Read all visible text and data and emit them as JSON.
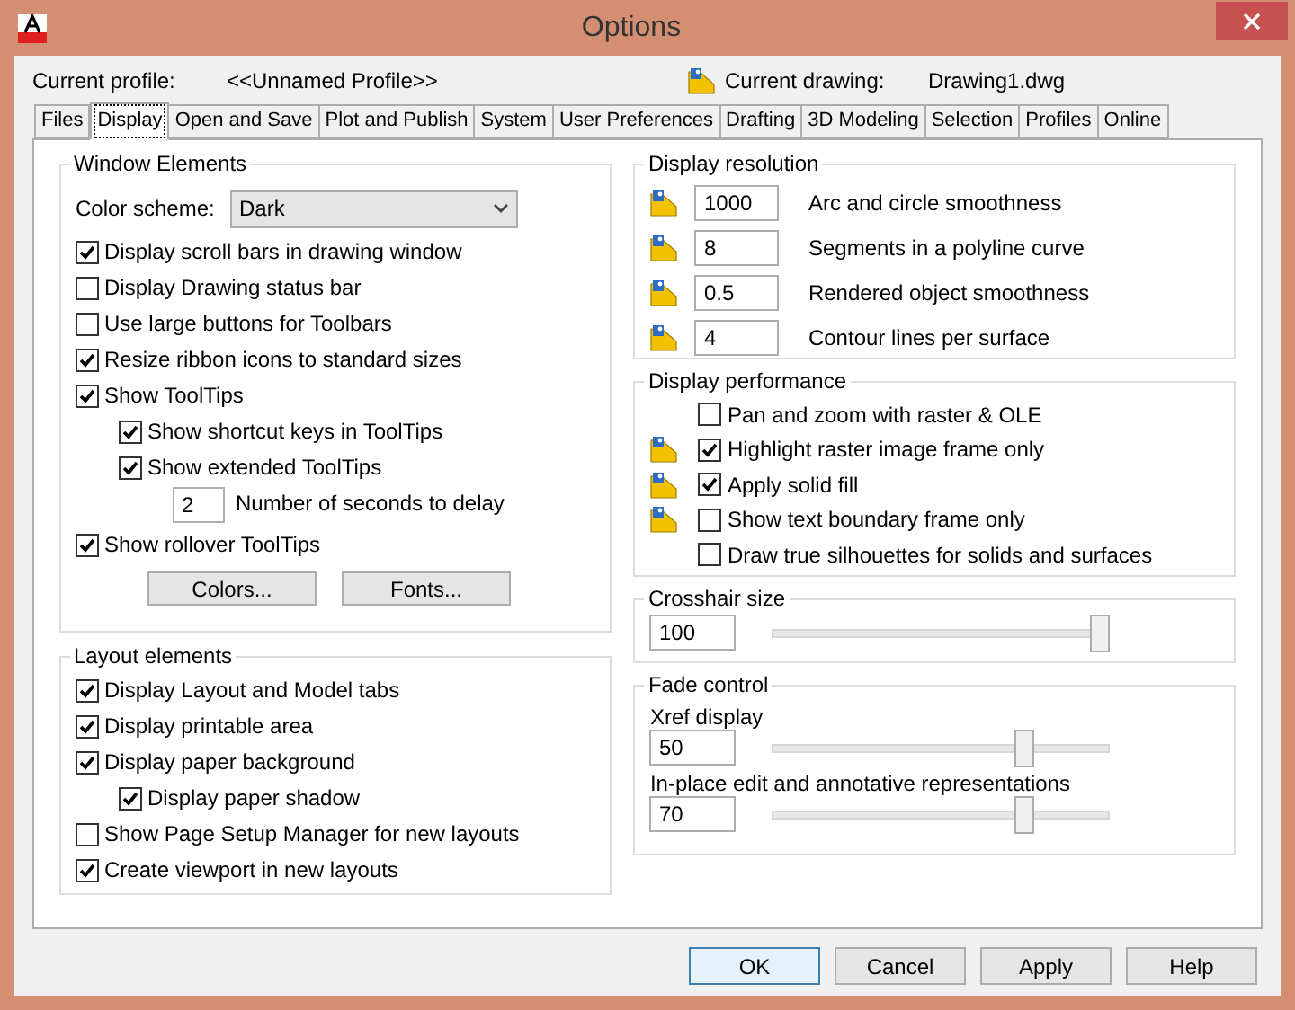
{
  "window": {
    "title": "Options"
  },
  "profile": {
    "label": "Current profile:",
    "value": "<<Unnamed Profile>>"
  },
  "drawing": {
    "label": "Current drawing:",
    "value": "Drawing1.dwg"
  },
  "tabs": [
    {
      "label": "Files",
      "selected": false
    },
    {
      "label": "Display",
      "selected": true
    },
    {
      "label": "Open and Save",
      "selected": false
    },
    {
      "label": "Plot and Publish",
      "selected": false
    },
    {
      "label": "System",
      "selected": false
    },
    {
      "label": "User Preferences",
      "selected": false
    },
    {
      "label": "Drafting",
      "selected": false
    },
    {
      "label": "3D Modeling",
      "selected": false
    },
    {
      "label": "Selection",
      "selected": false
    },
    {
      "label": "Profiles",
      "selected": false
    },
    {
      "label": "Online",
      "selected": false
    }
  ],
  "window_elements": {
    "title": "Window Elements",
    "color_scheme": {
      "label": "Color scheme:",
      "value": "Dark"
    },
    "items": [
      {
        "kind": "checkbox",
        "label": "Display scroll bars in drawing window",
        "checked": true
      },
      {
        "kind": "checkbox",
        "label": "Display Drawing status bar",
        "checked": false
      },
      {
        "kind": "checkbox",
        "label": "Use large buttons for Toolbars",
        "checked": false
      },
      {
        "kind": "checkbox",
        "label": "Resize ribbon icons to standard sizes",
        "checked": true
      },
      {
        "kind": "checkbox",
        "label": "Show ToolTips",
        "checked": true,
        "children": [
          {
            "kind": "checkbox",
            "label": "Show shortcut keys in ToolTips",
            "checked": true
          },
          {
            "kind": "checkbox",
            "label": "Show extended ToolTips",
            "checked": true,
            "children": [
              {
                "kind": "number",
                "value": "2",
                "label": "Number of seconds to delay"
              }
            ]
          }
        ]
      },
      {
        "kind": "checkbox",
        "label": "Show rollover ToolTips",
        "checked": true
      }
    ],
    "buttons": [
      "Colors...",
      "Fonts..."
    ]
  },
  "layout_elements": {
    "title": "Layout elements",
    "items": [
      {
        "kind": "checkbox",
        "label": "Display Layout and Model tabs",
        "checked": true
      },
      {
        "kind": "checkbox",
        "label": "Display printable area",
        "checked": true
      },
      {
        "kind": "checkbox",
        "label": "Display paper background",
        "checked": true,
        "children": [
          {
            "kind": "checkbox",
            "label": "Display paper shadow",
            "checked": true
          }
        ]
      },
      {
        "kind": "checkbox",
        "label": "Show Page Setup Manager for new layouts",
        "checked": false
      },
      {
        "kind": "checkbox",
        "label": "Create viewport in new layouts",
        "checked": true
      }
    ]
  },
  "display_resolution": {
    "title": "Display resolution",
    "rows": [
      {
        "value": "1000",
        "label": "Arc and circle smoothness"
      },
      {
        "value": "8",
        "label": "Segments in a polyline curve"
      },
      {
        "value": "0.5",
        "label": "Rendered object smoothness"
      },
      {
        "value": "4",
        "label": "Contour lines per surface"
      }
    ]
  },
  "display_performance": {
    "title": "Display performance",
    "items": [
      {
        "label": "Pan and zoom with raster & OLE",
        "checked": false,
        "drawing_icon": false
      },
      {
        "label": "Highlight raster image frame only",
        "checked": true,
        "drawing_icon": true
      },
      {
        "label": "Apply solid fill",
        "checked": true,
        "drawing_icon": true
      },
      {
        "label": "Show text boundary frame only",
        "checked": false,
        "drawing_icon": true
      },
      {
        "label": "Draw true silhouettes for solids and surfaces",
        "checked": false,
        "drawing_icon": false
      }
    ]
  },
  "crosshair": {
    "title": "Crosshair size",
    "value": "100",
    "level": 1.0
  },
  "fade_control": {
    "title": "Fade control",
    "sliders": [
      {
        "label": "Xref display",
        "value": "50",
        "level": 0.76
      },
      {
        "label": "In-place edit and annotative representations",
        "value": "70",
        "level": 0.76
      }
    ]
  },
  "buttons": [
    {
      "label": "OK",
      "default": true
    },
    {
      "label": "Cancel",
      "default": false
    },
    {
      "label": "Apply",
      "default": false
    },
    {
      "label": "Help",
      "default": false
    }
  ]
}
